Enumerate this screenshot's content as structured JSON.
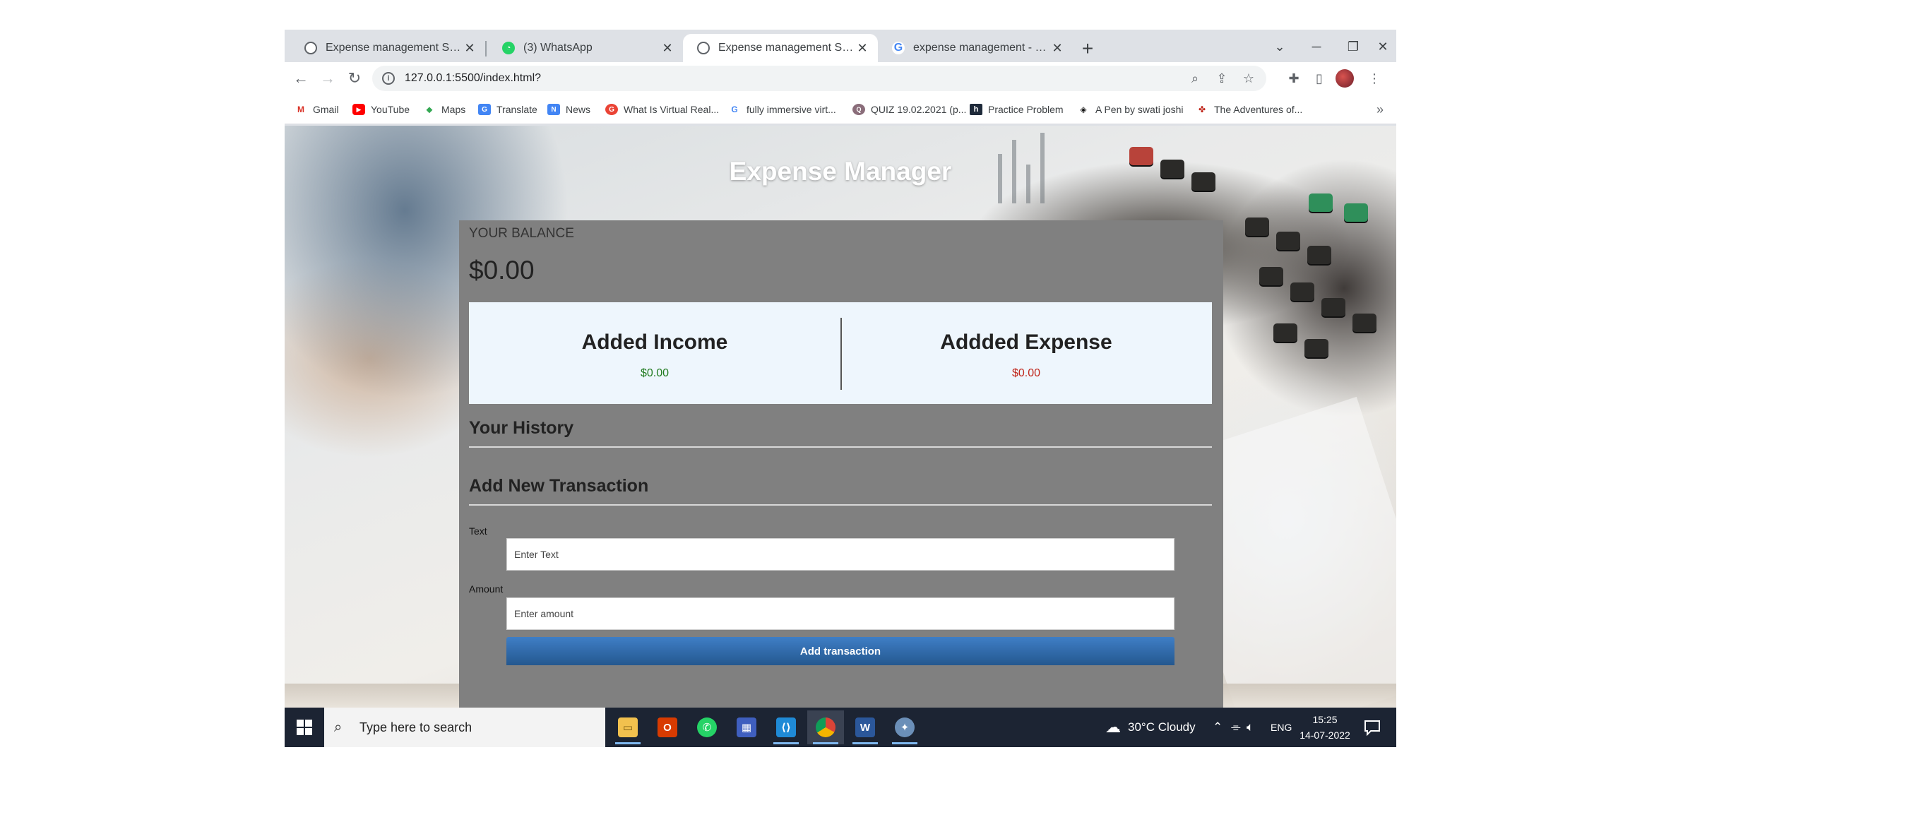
{
  "browser": {
    "tabs": [
      {
        "title": "Expense management System",
        "favicon": "globe-icon",
        "active": false
      },
      {
        "title": "(3) WhatsApp",
        "favicon": "whatsapp-icon",
        "active": false
      },
      {
        "title": "Expense management System",
        "favicon": "globe-icon",
        "active": true
      },
      {
        "title": "expense management - Google S",
        "favicon": "google-icon",
        "active": false
      }
    ],
    "new_tab_symbol": "+",
    "url": "127.0.0.1:5500/index.html?",
    "bookmarks": [
      {
        "label": "Gmail",
        "icon": "gmail-icon"
      },
      {
        "label": "YouTube",
        "icon": "youtube-icon"
      },
      {
        "label": "Maps",
        "icon": "maps-icon"
      },
      {
        "label": "Translate",
        "icon": "translate-icon"
      },
      {
        "label": "News",
        "icon": "news-icon"
      },
      {
        "label": "What Is Virtual Real...",
        "icon": "site-icon"
      },
      {
        "label": "fully immersive virt...",
        "icon": "google-icon"
      },
      {
        "label": "QUIZ 19.02.2021 (p...",
        "icon": "site-icon"
      },
      {
        "label": "Practice Problem",
        "icon": "hackerrank-icon"
      },
      {
        "label": "A Pen by swati joshi",
        "icon": "codepen-icon"
      },
      {
        "label": "The Adventures of...",
        "icon": "site-icon"
      }
    ],
    "bookmarks_overflow": "»"
  },
  "app": {
    "title": "Expense Manager",
    "balance_label": "YOUR BALANCE",
    "balance_value": "$0.00",
    "income_heading": "Added Income",
    "income_value": "$0.00",
    "expense_heading": "Addded Expense",
    "expense_value": "$0.00",
    "history_heading": "Your History",
    "add_heading": "Add New Transaction",
    "text_label": "Text",
    "text_placeholder": "Enter Text",
    "amount_label": "Amount",
    "amount_placeholder": "Enter amount",
    "add_button": "Add transaction",
    "colors": {
      "income": "#1f7a1f",
      "expense": "#c0261b",
      "button": "#2d6aa8",
      "panel": "#808080"
    }
  },
  "taskbar": {
    "search_placeholder": "Type here to search",
    "apps": [
      "file-explorer-icon",
      "office-icon",
      "whatsapp-icon",
      "app-icon",
      "vscode-icon",
      "chrome-icon",
      "word-icon",
      "settings-app-icon"
    ],
    "weather": "30°C  Cloudy",
    "language": "ENG",
    "time": "15:25",
    "date": "14-07-2022"
  }
}
